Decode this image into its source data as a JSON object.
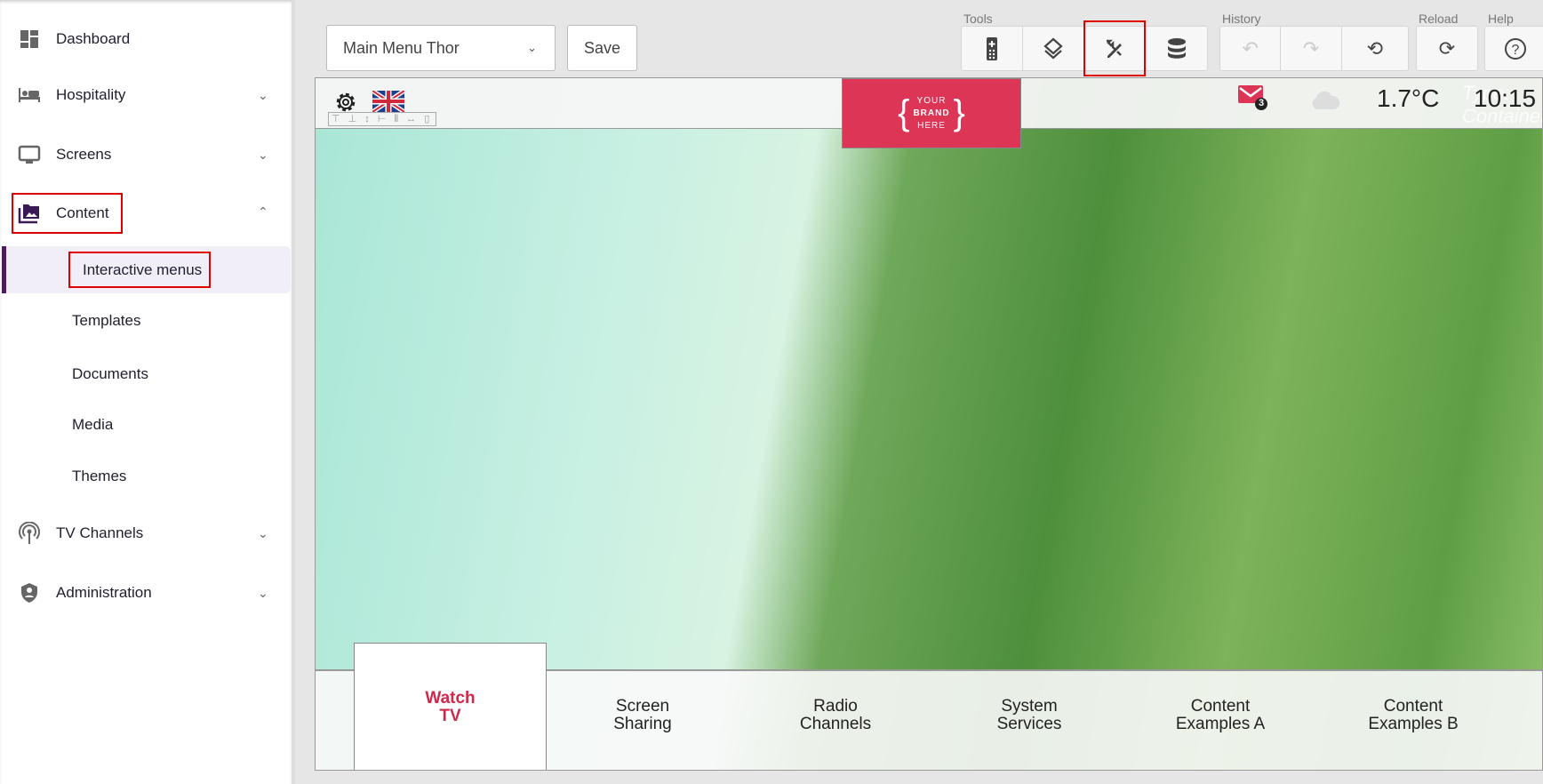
{
  "sidebar": {
    "items": [
      {
        "label": "Dashboard",
        "icon": "dashboard-icon"
      },
      {
        "label": "Hospitality",
        "icon": "bed-icon"
      },
      {
        "label": "Screens",
        "icon": "monitor-icon"
      },
      {
        "label": "Content",
        "icon": "photo-library-icon"
      },
      {
        "label": "TV Channels",
        "icon": "broadcast-icon"
      },
      {
        "label": "Administration",
        "icon": "shield-user-icon"
      }
    ],
    "content_sub": [
      "Interactive menus",
      "Templates",
      "Documents",
      "Media",
      "Themes"
    ]
  },
  "toolbar": {
    "menu_select": "Main Menu Thor",
    "save_label": "Save",
    "tools_label": "Tools",
    "history_label": "History",
    "reload_label": "Reload",
    "help_label": "Help"
  },
  "preview": {
    "brand": [
      "YOUR",
      "BRAND",
      "HERE"
    ],
    "mail_count": "3",
    "temperature": "1.7°C",
    "time": "10:15",
    "type_hint": "Type: Container",
    "nav": [
      {
        "l1": "Watch",
        "l2": "TV"
      },
      {
        "l1": "Screen",
        "l2": "Sharing"
      },
      {
        "l1": "Radio",
        "l2": "Channels"
      },
      {
        "l1": "System",
        "l2": "Services"
      },
      {
        "l1": "Content",
        "l2": "Examples A"
      },
      {
        "l1": "Content",
        "l2": "Examples B"
      }
    ]
  },
  "colors": {
    "accent": "#4a1e5e",
    "brand": "#dc3555",
    "highlight": "#e00000"
  }
}
